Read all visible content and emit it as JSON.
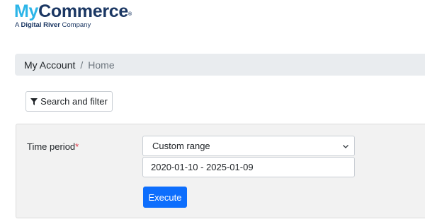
{
  "logo": {
    "my": "My",
    "commerce": "Commerce",
    "registered": "®",
    "sub_prefix": "A",
    "sub_brand": "Digital River",
    "sub_suffix": "Company"
  },
  "breadcrumb": {
    "items": [
      "My Account",
      "Home"
    ],
    "separator": "/"
  },
  "filter_button": {
    "label": "Search and filter",
    "icon": "filter-icon"
  },
  "form": {
    "time_period_label": "Time period",
    "required_mark": "*",
    "time_period_value": "Custom range",
    "date_range_value": "2020-01-10 - 2025-01-09",
    "execute_label": "Execute"
  },
  "colors": {
    "accent": "#0d6efd",
    "logo_light": "#2cb5e8",
    "logo_dark": "#1b3763",
    "required": "#dc3545"
  }
}
